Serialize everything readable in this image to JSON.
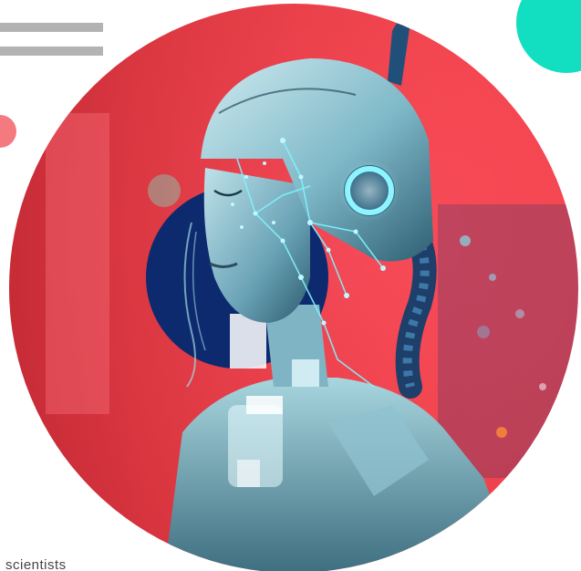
{
  "caption": {
    "text": "scientists"
  },
  "colors": {
    "teal": "#12dfc1",
    "red": "#f2454e",
    "gray_bar": "#b3b3b3",
    "pink": "#f47a80",
    "cyan_glow": "#7ff4ff",
    "navy": "#0d2a6e"
  },
  "image": {
    "subject": "robot-woman-portrait"
  }
}
